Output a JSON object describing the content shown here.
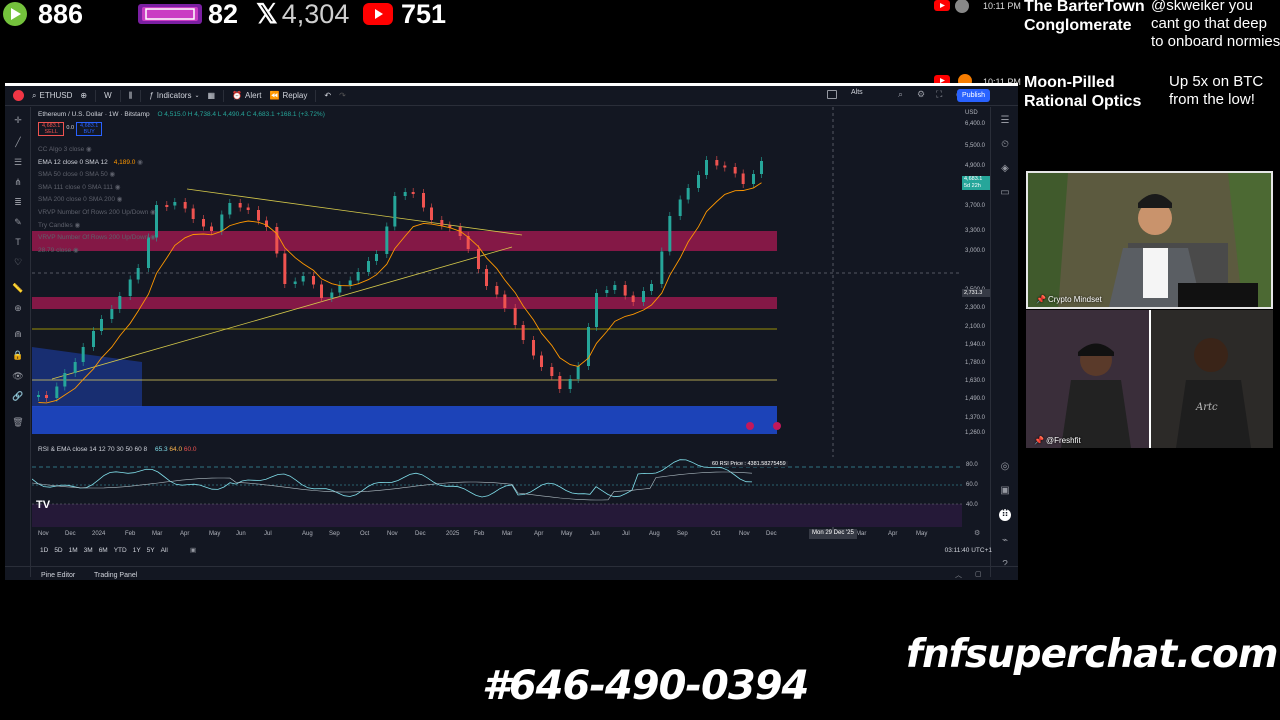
{
  "top_stats": {
    "rumble_count": "886",
    "kick_count": "82",
    "x_count": "4,304",
    "youtube_count": "751"
  },
  "superchats": [
    {
      "time": "10:11 PM",
      "name": "The BarterTown Conglomerate",
      "message": "@skweiker you cant go that deep to onboard normies"
    },
    {
      "time": "10:11 PM",
      "name": "Moon-Pilled Rational Optics",
      "message": "Up 5x on BTC from the low!"
    }
  ],
  "tv": {
    "toolbar": {
      "symbol": "ETHUSD",
      "interval": "W",
      "indicators": "Indicators",
      "alert": "Alert",
      "replay": "Replay",
      "alts": "Alts",
      "publish": "Publish"
    },
    "legend": {
      "title": "Ethereum / U.S. Dollar · 1W · Bitstamp",
      "ohlc": "O 4,515.0  H 4,738.4  L 4,490.4  C 4,683.1  +168.1 (+3.72%)",
      "sell_price": "4,683.1",
      "sell_label": "SELL",
      "spread": "0.0",
      "buy_price": "4,683.1",
      "buy_label": "BUY",
      "rows": [
        {
          "text": "CC Algo 3 close",
          "dim": true
        },
        {
          "text": "EMA 12 close 0 SMA 12",
          "value": "4,189.0",
          "dim": false
        },
        {
          "text": "SMA 50 close 0 SMA 50",
          "dim": true
        },
        {
          "text": "SMA 111 close 0 SMA 111",
          "dim": true
        },
        {
          "text": "SMA 200 close 0 SMA 200",
          "dim": true
        },
        {
          "text": "VRVP Number Of Rows 200 Up/Down",
          "dim": true
        },
        {
          "text": "Try Candles",
          "dim": true
        },
        {
          "text": "VRVP Number Of Rows 200 Up/Down",
          "dim": true
        },
        {
          "text": "28.79 close",
          "dim": true
        }
      ]
    },
    "price_axis": {
      "currency": "USD",
      "labels": [
        "6,400.0",
        "5,500.0",
        "4,900.0",
        "4,100.0",
        "3,700.0",
        "3,300.0",
        "3,000.0",
        "2,731.3",
        "2,500.0",
        "2,300.0",
        "2,100.0",
        "1,940.0",
        "1,780.0",
        "1,630.0",
        "1,490.0",
        "1,370.0",
        "1,260.0"
      ],
      "current_price": "4,683.1",
      "current_countdown": "5d 22h",
      "crosshair_price": "2,731.3"
    },
    "rsi": {
      "title": "RSI & EMA close 14 12 70 30 50 60 8",
      "v1": "65.3",
      "v2": "64.0",
      "v3": "60.0",
      "tooltip": "60 RSI Price : 4381.58275459",
      "axis": [
        "80.0",
        "60.0",
        "40.0"
      ]
    },
    "time_axis": [
      "Nov",
      "Dec",
      "2024",
      "Feb",
      "Mar",
      "Apr",
      "May",
      "Jun",
      "Jul",
      "Aug",
      "Sep",
      "Oct",
      "Nov",
      "Dec",
      "2025",
      "Feb",
      "Mar",
      "Apr",
      "May",
      "Jun",
      "Jul",
      "Aug",
      "Sep",
      "Oct",
      "Nov",
      "Dec",
      "Mon 29 Dec '25",
      "Feb",
      "Mar",
      "Apr",
      "May"
    ],
    "crosshair_date": "Mon 29 Dec '25",
    "range_buttons": [
      "1D",
      "5D",
      "1M",
      "3M",
      "6M",
      "YTD",
      "1Y",
      "5Y",
      "All"
    ],
    "clock": "03:11:40 UTC+1",
    "bottom_tabs": [
      "Pine Editor",
      "Trading Panel"
    ]
  },
  "cams": [
    {
      "label": "Crypto Mindset"
    },
    {
      "label": "@Freshfit"
    }
  ],
  "promo": {
    "site": "fnfsuperchat.com",
    "phone": "#646-490-0394"
  },
  "colors": {
    "accent": "#2962ff",
    "bull": "#26a69a",
    "bear": "#ef5350",
    "zone_red": "#c2185b",
    "zone_blue": "#1e4bd2",
    "rsi": "#80deea"
  }
}
